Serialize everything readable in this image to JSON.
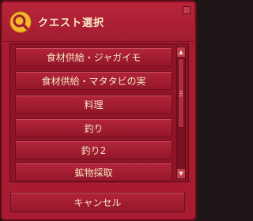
{
  "window": {
    "title": "クエスト選択",
    "title_icon": "search-icon"
  },
  "list": {
    "items": [
      {
        "label": "食材供給・ジャガイモ"
      },
      {
        "label": "食材供給・マタタビの実"
      },
      {
        "label": "料理"
      },
      {
        "label": "釣り"
      },
      {
        "label": "釣り2"
      },
      {
        "label": "鉱物採取"
      }
    ]
  },
  "scrollbar": {
    "up_icon": "chevron-up-icon",
    "down_icon": "chevron-down-icon"
  },
  "footer": {
    "cancel_label": "キャンセル"
  },
  "colors": {
    "window_bg": "#a81b31",
    "text": "#f6e8c4",
    "icon_accent": "#f2b72b"
  }
}
